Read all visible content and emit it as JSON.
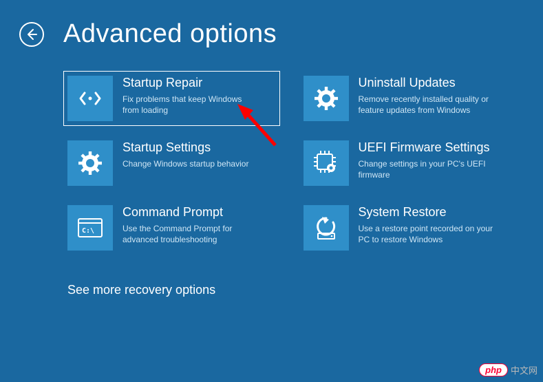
{
  "header": {
    "title": "Advanced options"
  },
  "tiles": [
    {
      "title": "Startup Repair",
      "desc": "Fix problems that keep Windows from loading"
    },
    {
      "title": "Uninstall Updates",
      "desc": "Remove recently installed quality or feature updates from Windows"
    },
    {
      "title": "Startup Settings",
      "desc": "Change Windows startup behavior"
    },
    {
      "title": "UEFI Firmware Settings",
      "desc": "Change settings in your PC's UEFI firmware"
    },
    {
      "title": "Command Prompt",
      "desc": "Use the Command Prompt for advanced troubleshooting"
    },
    {
      "title": "System Restore",
      "desc": "Use a restore point recorded on your PC to restore Windows"
    }
  ],
  "more_link": "See more recovery options",
  "watermark": {
    "brand": "php",
    "site": "中文网"
  }
}
